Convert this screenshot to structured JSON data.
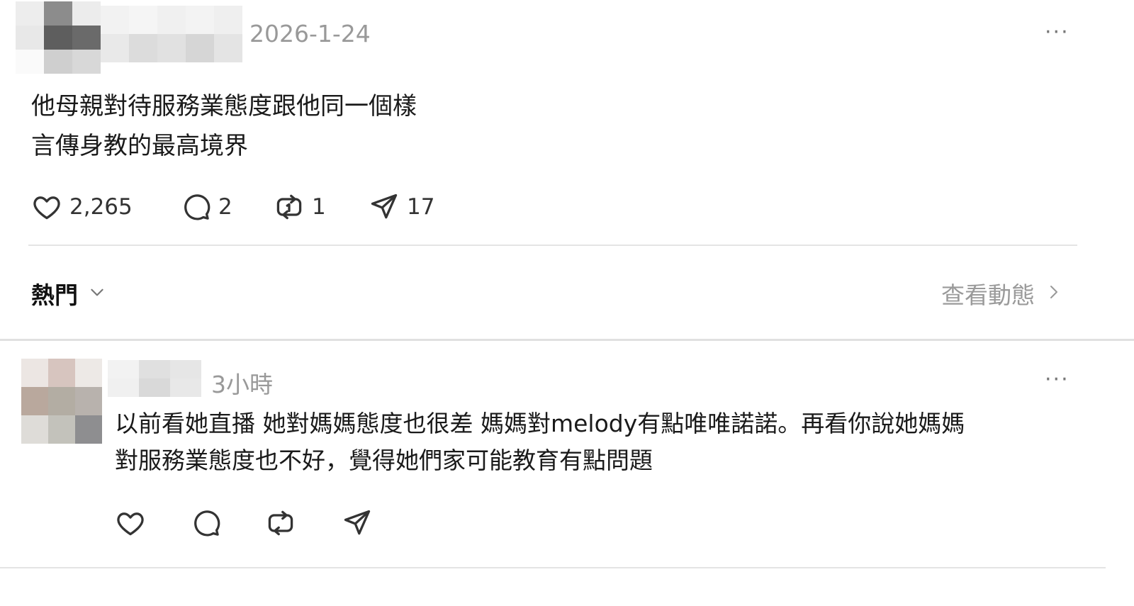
{
  "post": {
    "date": "2026-1-24",
    "more": "···",
    "text_lines": [
      "他母親對待服務業態度跟他同一個樣",
      "言傳身教的最高境界"
    ],
    "likes": "2,265",
    "comments": "2",
    "reposts": "1",
    "shares": "17"
  },
  "sort_bar": {
    "label": "熱門",
    "activity_link": "查看動態"
  },
  "reply": {
    "time": "3小時",
    "more": "···",
    "text_lines": [
      "以前看她直播 她對媽媽態度也很差 媽媽對melody有點唯唯諾諾。再看你說她媽媽",
      "對服務業態度也不好，覺得她們家可能教育有點問題"
    ]
  },
  "icons": {
    "like": "heart-icon",
    "comment": "comment-bubble-icon",
    "repost": "repost-icon",
    "share": "send-icon",
    "sort": "chevron-down-icon",
    "activity": "chevron-right-icon"
  },
  "colors": {
    "text": "#1a1a1a",
    "muted": "#999999",
    "divider": "#e4e4e4"
  }
}
